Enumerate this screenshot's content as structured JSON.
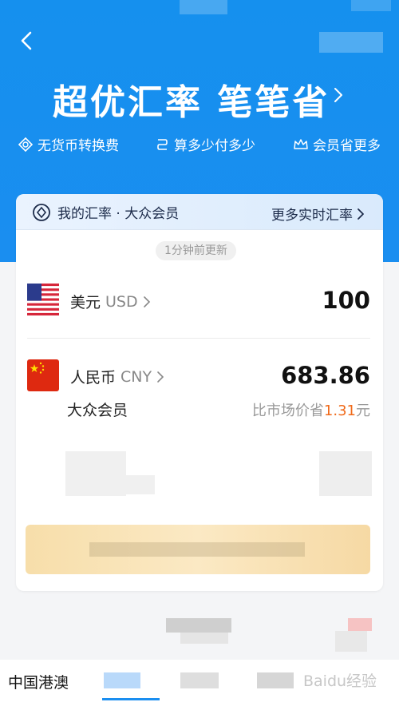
{
  "header": {
    "back_label": "<",
    "headline": "超优汇率 笔笔省",
    "perks": [
      "无货币转换费",
      "算多少付多少",
      "会员省更多"
    ]
  },
  "rate_card": {
    "title": "我的汇率 · 大众会员",
    "more_link": "更多实时汇率",
    "updated_label": "1分钟前更新",
    "from": {
      "name": "美元",
      "code": "USD",
      "amount": "100",
      "flag_icon": "us-flag-icon"
    },
    "to": {
      "name": "人民币",
      "code": "CNY",
      "amount": "683.86",
      "flag_icon": "cn-flag-icon",
      "member_label": "大众会员",
      "saving_prefix": "比市场价省",
      "saving_amount": "1.31",
      "saving_unit": "元"
    }
  },
  "tabs": {
    "first": "中国港澳",
    "watermark": "Baidu经验"
  },
  "colors": {
    "brand_blue": "#1a8ef0",
    "highlight_orange": "#f06a1a"
  }
}
